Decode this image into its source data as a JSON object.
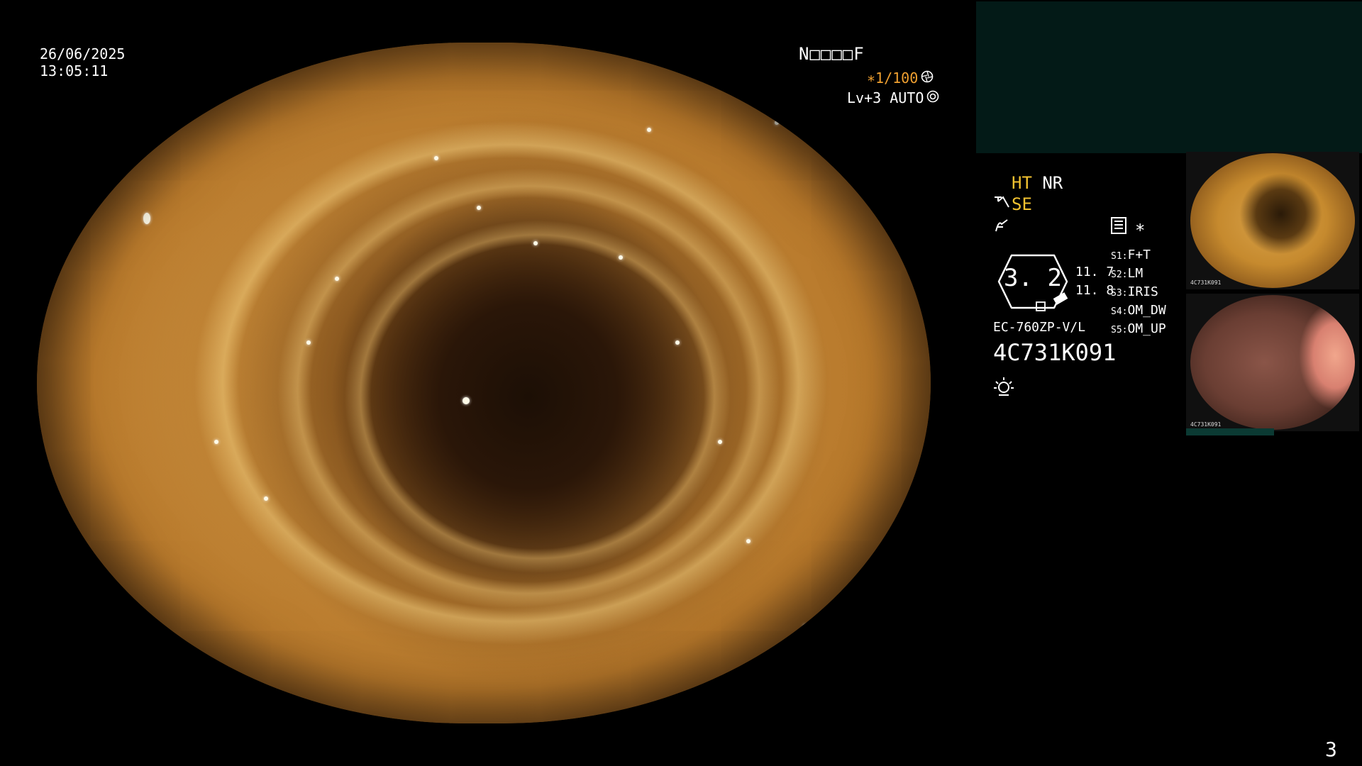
{
  "main_view": {
    "date": "26/06/2025",
    "time": "13:05:11",
    "patient_code": "N□□□□F",
    "shutter": "∗1/100",
    "shutter_icon": "shutter-icon",
    "light_level": "Lv+3 AUTO",
    "light_icon": "auto-iris-icon"
  },
  "info_panel": {
    "ht": "HT",
    "nr": "NR",
    "se": "SE",
    "structure_icon": "structure-enhance-icon",
    "freeze_icon": "freeze-icon",
    "memory_icon": "memory-card-icon",
    "asterisk": "∗",
    "zoom_value": "3. 2",
    "gauge_upper": "11. 7",
    "gauge_lower": "11. 8",
    "scope_model": "EC-760ZP-V/L",
    "serial": "4C731K091",
    "lamp_icon": "lamp-icon",
    "switches": [
      {
        "key": "S1:",
        "value": "F+T"
      },
      {
        "key": "S2:",
        "value": "LM"
      },
      {
        "key": "S3:",
        "value": "IRIS"
      },
      {
        "key": "S4:",
        "value": "OM_DW"
      },
      {
        "key": "S5:",
        "value": "OM_UP"
      }
    ]
  },
  "thumbnails": [
    {
      "serial": "4C731K091"
    },
    {
      "serial": "4C731K091"
    }
  ],
  "page_number": "3",
  "colors": {
    "background": "#000000",
    "panel_teal": "#031a17",
    "yellow_accent": "#f2c230",
    "orange_accent": "#f0a030"
  }
}
